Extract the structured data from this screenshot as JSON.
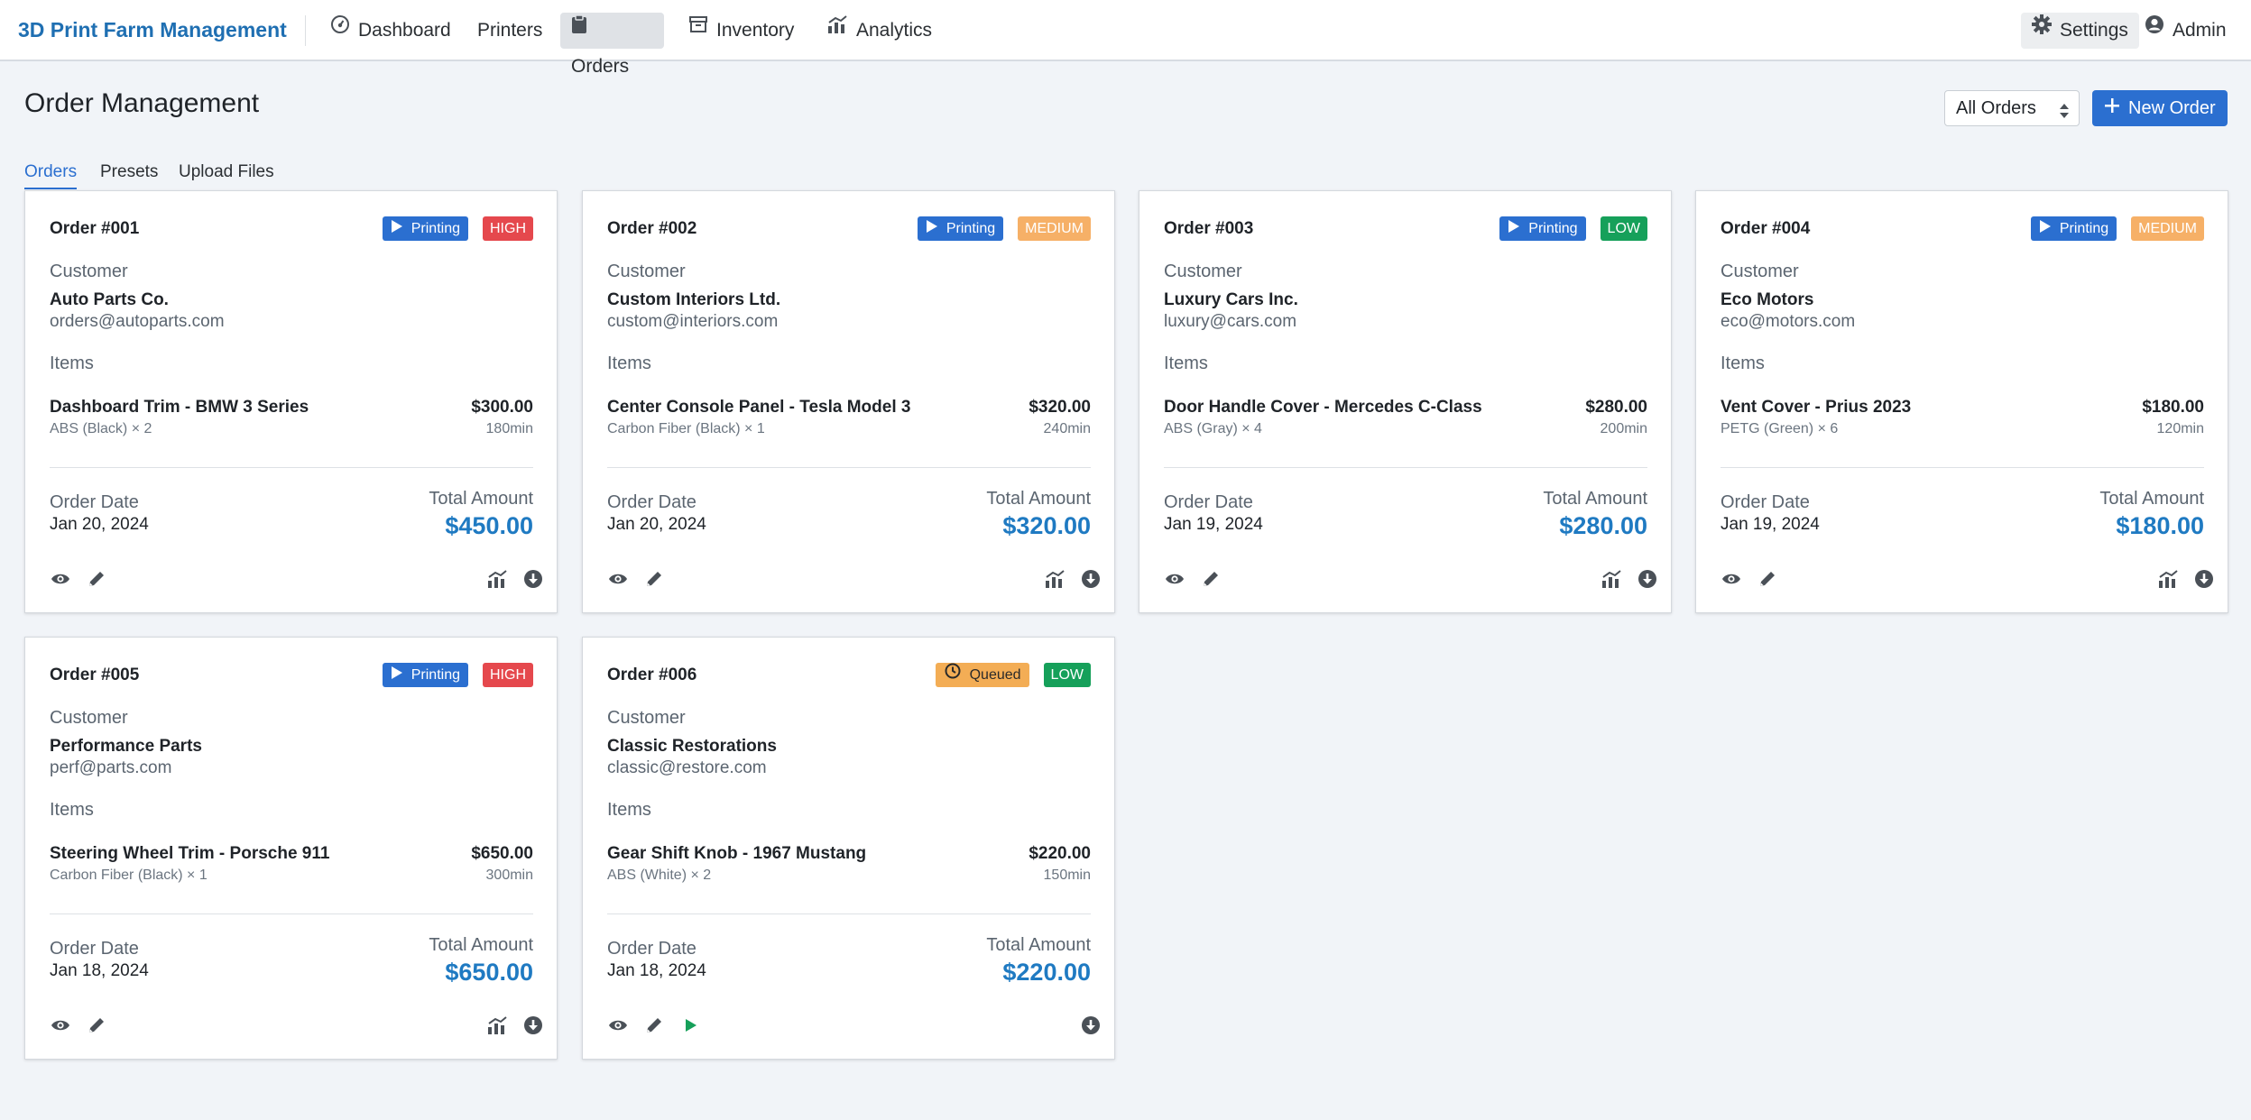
{
  "brand": "3D Print Farm Management",
  "nav": {
    "dashboard": "Dashboard",
    "printers": "Printers",
    "orders": "Orders",
    "inventory": "Inventory",
    "analytics": "Analytics",
    "settings": "Settings",
    "admin": "Admin"
  },
  "page": {
    "title": "Order Management",
    "filter_value": "All Orders",
    "new_order_label": "New Order"
  },
  "tabs": [
    "Orders",
    "Presets",
    "Upload Files"
  ],
  "labels": {
    "customer": "Customer",
    "items": "Items",
    "order_date": "Order Date",
    "total_amount": "Total Amount"
  },
  "colors": {
    "accent": "#2b6fd0",
    "total": "#1f7ac2",
    "high": "#e5484d",
    "medium": "#f6b067",
    "low": "#16a05a",
    "queued": "#f3ad55"
  },
  "orders": [
    {
      "id": "Order #001",
      "status": "Printing",
      "priority": "HIGH",
      "customer_name": "Auto Parts Co.",
      "customer_email": "orders@autoparts.com",
      "item_name": "Dashboard Trim - BMW 3 Series",
      "item_detail": "ABS (Black) × 2",
      "item_price": "$300.00",
      "item_time": "180min",
      "order_date": "Jan 20, 2024",
      "total": "$450.00"
    },
    {
      "id": "Order #002",
      "status": "Printing",
      "priority": "MEDIUM",
      "customer_name": "Custom Interiors Ltd.",
      "customer_email": "custom@interiors.com",
      "item_name": "Center Console Panel - Tesla Model 3",
      "item_detail": "Carbon Fiber (Black) × 1",
      "item_price": "$320.00",
      "item_time": "240min",
      "order_date": "Jan 20, 2024",
      "total": "$320.00"
    },
    {
      "id": "Order #003",
      "status": "Printing",
      "priority": "LOW",
      "customer_name": "Luxury Cars Inc.",
      "customer_email": "luxury@cars.com",
      "item_name": "Door Handle Cover - Mercedes C-Class",
      "item_detail": "ABS (Gray) × 4",
      "item_price": "$280.00",
      "item_time": "200min",
      "order_date": "Jan 19, 2024",
      "total": "$280.00"
    },
    {
      "id": "Order #004",
      "status": "Printing",
      "priority": "MEDIUM",
      "customer_name": "Eco Motors",
      "customer_email": "eco@motors.com",
      "item_name": "Vent Cover - Prius 2023",
      "item_detail": "PETG (Green) × 6",
      "item_price": "$180.00",
      "item_time": "120min",
      "order_date": "Jan 19, 2024",
      "total": "$180.00"
    },
    {
      "id": "Order #005",
      "status": "Printing",
      "priority": "HIGH",
      "customer_name": "Performance Parts",
      "customer_email": "perf@parts.com",
      "item_name": "Steering Wheel Trim - Porsche 911",
      "item_detail": "Carbon Fiber (Black) × 1",
      "item_price": "$650.00",
      "item_time": "300min",
      "order_date": "Jan 18, 2024",
      "total": "$650.00"
    },
    {
      "id": "Order #006",
      "status": "Queued",
      "priority": "LOW",
      "customer_name": "Classic Restorations",
      "customer_email": "classic@restore.com",
      "item_name": "Gear Shift Knob - 1967 Mustang",
      "item_detail": "ABS (White) × 2",
      "item_price": "$220.00",
      "item_time": "150min",
      "order_date": "Jan 18, 2024",
      "total": "$220.00"
    }
  ]
}
